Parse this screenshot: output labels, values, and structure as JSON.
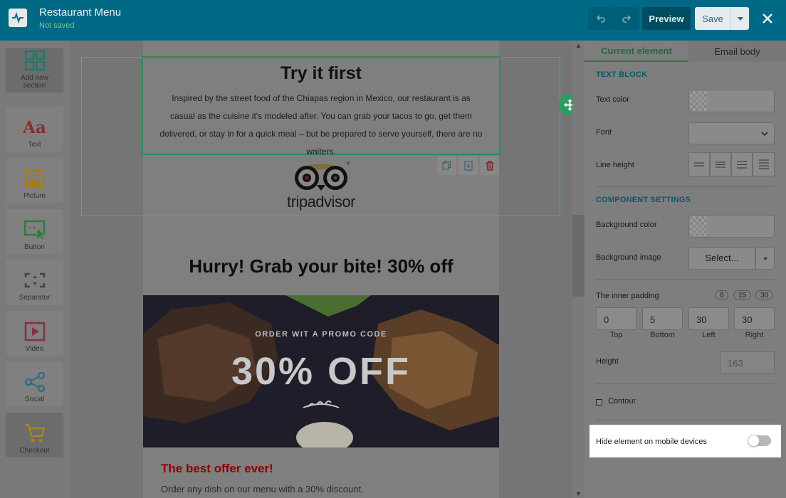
{
  "header": {
    "app_title": "Restaurant Menu",
    "save_status": "Not saved",
    "preview_label": "Preview",
    "save_label": "Save"
  },
  "tools": [
    {
      "label": "Add new section",
      "icon": "grid-icon",
      "color": "#1e7a6a"
    },
    {
      "label": "Text",
      "icon": "text-icon",
      "color": "#8a2f2f"
    },
    {
      "label": "Picture",
      "icon": "picture-icon",
      "color": "#a87a1e"
    },
    {
      "label": "Button",
      "icon": "button-icon",
      "color": "#2f7a3b"
    },
    {
      "label": "Separator",
      "icon": "separator-icon",
      "color": "#444444"
    },
    {
      "label": "Video",
      "icon": "video-icon",
      "color": "#8a2f44"
    },
    {
      "label": "Social",
      "icon": "share-icon",
      "color": "#2e6f86"
    },
    {
      "label": "Checkout",
      "icon": "cart-icon",
      "color": "#a8861e"
    }
  ],
  "canvas": {
    "text_block": {
      "title": "Try it first",
      "body": "Inspired by the street food of the Chiapas region in Mexico, our restaurant is as casual as the cuisine it's modeled after. You can grab your tacos to go, get them delivered, or stay in for a quick meal – but be prepared to serve yourself, there are no waiters."
    },
    "logo": {
      "trip": "trip",
      "advisor": "advisor",
      "reg": "®"
    },
    "hurry_heading": "Hurry! Grab your bite! 30% off",
    "promo": {
      "subtitle": "ORDER WIT A PROMO CODE",
      "headline": "30% OFF"
    },
    "offer_title": "The best offer ever!",
    "offer_text": "Order any dish on our menu with a 30% discount."
  },
  "panel": {
    "tabs": [
      "Current element",
      "Email body"
    ],
    "text_block_title": "TEXT BLOCK",
    "text_color_label": "Text color",
    "font_label": "Font",
    "line_height_label": "Line height",
    "component_settings_title": "COMPONENT SETTINGS",
    "bg_color_label": "Background color",
    "bg_image_label": "Background image",
    "bg_image_select": "Select...",
    "inner_padding_label": "The inner padding",
    "padding_presets": [
      "0",
      "15",
      "30"
    ],
    "padding": [
      {
        "value": "0",
        "label": "Top"
      },
      {
        "value": "5",
        "label": "Bottom"
      },
      {
        "value": "30",
        "label": "Left"
      },
      {
        "value": "30",
        "label": "Right"
      }
    ],
    "height_label": "Height",
    "height_placeholder": "163",
    "contour_label": "Contour",
    "hide_mobile_label": "Hide element on mobile devices"
  }
}
